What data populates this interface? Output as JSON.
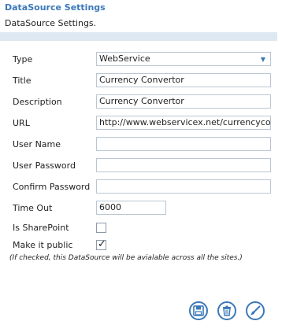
{
  "header": {
    "title": "DataSource Settings",
    "subtitle": "DataSource Settings."
  },
  "form": {
    "type_label": "Type",
    "type_value": "WebService",
    "title_label": "Title",
    "title_value": "Currency Convertor",
    "description_label": "Description",
    "description_value": "Currency Convertor",
    "url_label": "URL",
    "url_value": "http://www.webservicex.net/currencyconvertor.asmx?WSDL",
    "username_label": "User Name",
    "username_value": "",
    "password_label": "User Password",
    "password_value": "",
    "confirm_password_label": "Confirm Password",
    "confirm_password_value": "",
    "timeout_label": "Time Out",
    "timeout_value": "6000",
    "is_sharepoint_label": "Is SharePoint",
    "is_sharepoint_checked": false,
    "make_public_label": "Make it public",
    "make_public_checked": true,
    "public_note": "(If checked, this DataSource will be avialable across all the sites.)"
  },
  "actions": {
    "save_icon": "save-icon",
    "delete_icon": "trash-icon",
    "clear_icon": "brush-icon",
    "accent_color": "#3b78b8"
  }
}
